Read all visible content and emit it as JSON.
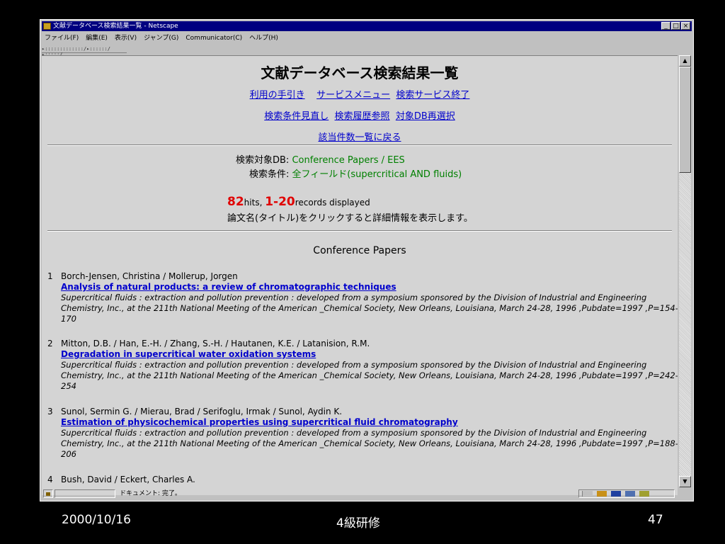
{
  "window": {
    "title": "文献データベース検索結果一覧 - Netscape",
    "controls": [
      "_",
      "□",
      "×"
    ]
  },
  "menu": [
    "ファイル(F)",
    "編集(E)",
    "表示(V)",
    "ジャンプ(G)",
    "Communicator(C)",
    "ヘルプ(H)"
  ],
  "tabs_text": "▸:::::::::::::/▸::::::/▸:::::/",
  "page": {
    "heading": "文献データベース検索結果一覧",
    "nav_row1": [
      "利用の手引き",
      "サービスメニュー",
      "検索サービス終了"
    ],
    "nav_row2": [
      "検索条件見直し",
      "検索履歴参照",
      "対象DB再選択"
    ],
    "nav_row3": [
      "該当件数一覧に戻る"
    ],
    "db_label": "検索対象DB: ",
    "db_value": "Conference Papers / EES",
    "cond_label": "検索条件: ",
    "cond_value": "全フィールド(supercritical AND fluids)",
    "hits_count": "82",
    "hits_label": "hits, ",
    "records_range": "1-20",
    "records_label": "records displayed",
    "note": "論文名(タイトル)をクリックすると詳細情報を表示します。",
    "section_title": "Conference Papers"
  },
  "records": [
    {
      "num": "1",
      "authors": "Borch-Jensen, Christina / Mollerup, Jorgen",
      "title": "Analysis of natural products: a review of chromatographic techniques",
      "source": "Supercritical fluids : extraction and pollution prevention : developed from a symposium sponsored by the Division of Industrial and Engineering Chemistry, Inc., at the 211th National Meeting of the American _Chemical Society, New Orleans, Louisiana, March 24-28, 1996 ,Pubdate=1997 ,P=154-170"
    },
    {
      "num": "2",
      "authors": "Mitton, D.B. / Han, E.-H. / Zhang, S.-H. / Hautanen, K.E. / Latanision, R.M.",
      "title": "Degradation in supercritical water oxidation systems",
      "source": "Supercritical fluids : extraction and pollution prevention : developed from a symposium sponsored by the Division of Industrial and Engineering Chemistry, Inc., at the 211th National Meeting of the American _Chemical Society, New Orleans, Louisiana, March 24-28, 1996 ,Pubdate=1997 ,P=242-254"
    },
    {
      "num": "3",
      "authors": "Sunol, Sermin G. / Mierau, Brad / Serifoglu, Irmak / Sunol, Aydin K.",
      "title": "Estimation of physicochemical properties using supercritical fluid chromatography",
      "source": "Supercritical fluids : extraction and pollution prevention : developed from a symposium sponsored by the Division of Industrial and Engineering Chemistry, Inc., at the 211th National Meeting of the American _Chemical Society, New Orleans, Louisiana, March 24-28, 1996 ,Pubdate=1997 ,P=188-206"
    },
    {
      "num": "4",
      "authors": "Bush, David / Eckert, Charles A.",
      "title": "",
      "source": ""
    }
  ],
  "status": {
    "message": "ドキュメント: 完了。"
  },
  "footer": {
    "date": "2000/10/16",
    "center": "4級研修",
    "page_number": "47"
  }
}
